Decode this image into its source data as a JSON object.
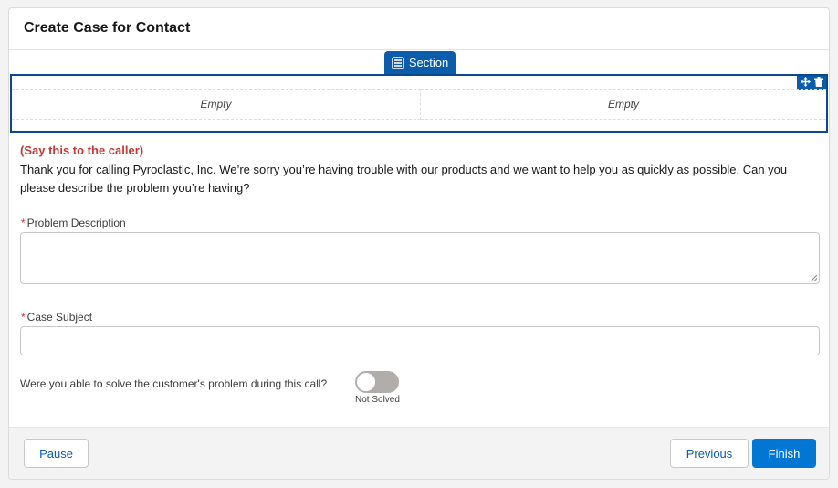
{
  "modal": {
    "title": "Create Case for Contact"
  },
  "section": {
    "tab_label": "Section",
    "columns": [
      "Empty",
      "Empty"
    ],
    "icons": {
      "tab": "section-layout-icon",
      "move": "move-icon",
      "delete": "trash-icon"
    }
  },
  "script": {
    "heading": "(Say this to the caller)",
    "text": "Thank you for calling Pyroclastic, Inc. We’re sorry you’re having trouble with our products and we want to help you as quickly as possible. Can you please describe the problem you’re having?"
  },
  "fields": {
    "required_mark": "*",
    "problem_description": {
      "label": "Problem Description",
      "value": ""
    },
    "case_subject": {
      "label": "Case Subject",
      "value": ""
    }
  },
  "toggle": {
    "question": "Were you able to solve the customer's problem during this call?",
    "status": "Not Solved",
    "checked": false
  },
  "footer": {
    "pause_label": "Pause",
    "previous_label": "Previous",
    "finish_label": "Finish"
  },
  "colors": {
    "brand": "#0176d3",
    "section_blue": "#0b5cab",
    "required_red": "#c23934"
  }
}
